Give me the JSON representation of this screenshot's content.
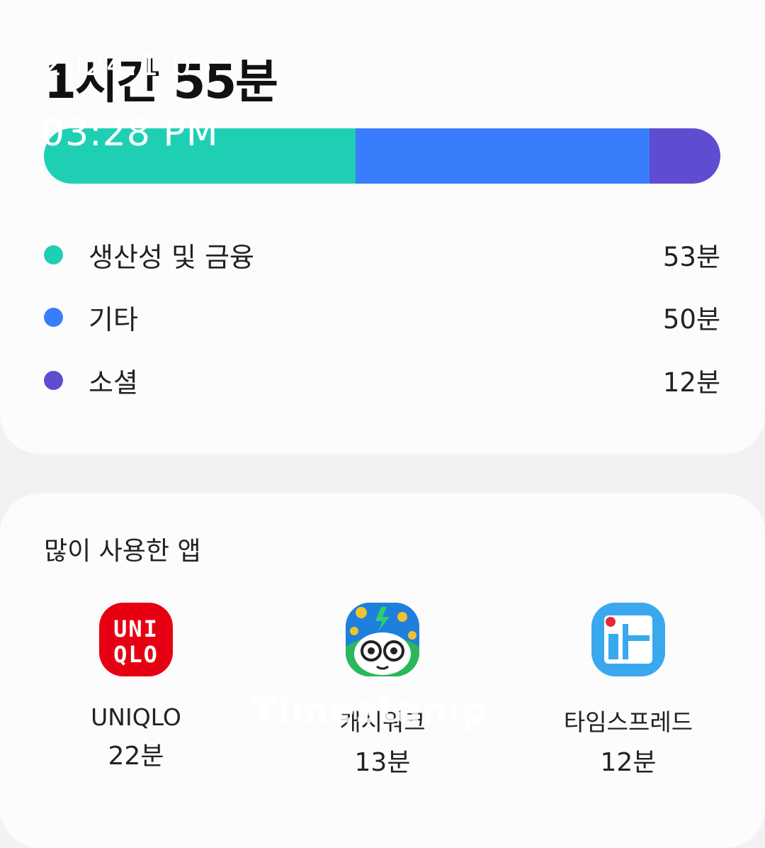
{
  "summary": {
    "total_time": "1시간 55분"
  },
  "usage_bar": {
    "segments": [
      {
        "category": "생산성 및 금융",
        "minutes": 53,
        "color": "#1fcfb4"
      },
      {
        "category": "기타",
        "minutes": 50,
        "color": "#3a7dfc"
      },
      {
        "category": "소셜",
        "minutes": 12,
        "color": "#5e4dd1"
      }
    ]
  },
  "legend": [
    {
      "label": "생산성 및 금융",
      "value": "53분",
      "color": "#1fcfb4"
    },
    {
      "label": "기타",
      "value": "50분",
      "color": "#3a7dfc"
    },
    {
      "label": "소셜",
      "value": "12분",
      "color": "#5e4dd1"
    }
  ],
  "top_apps": {
    "title": "많이 사용한 앱",
    "apps": [
      {
        "name": "UNIQLO",
        "time": "22분",
        "icon": "uniqlo-icon",
        "icon_text_1": "UNI",
        "icon_text_2": "QLO"
      },
      {
        "name": "캐시워크",
        "time": "13분",
        "icon": "cashwalk-icon"
      },
      {
        "name": "타임스프레드",
        "time": "12분",
        "icon": "timespread-icon"
      }
    ]
  },
  "overlay": {
    "date": "2024.1.05",
    "time": "03:28 PM",
    "watermark": "Timestamp"
  }
}
